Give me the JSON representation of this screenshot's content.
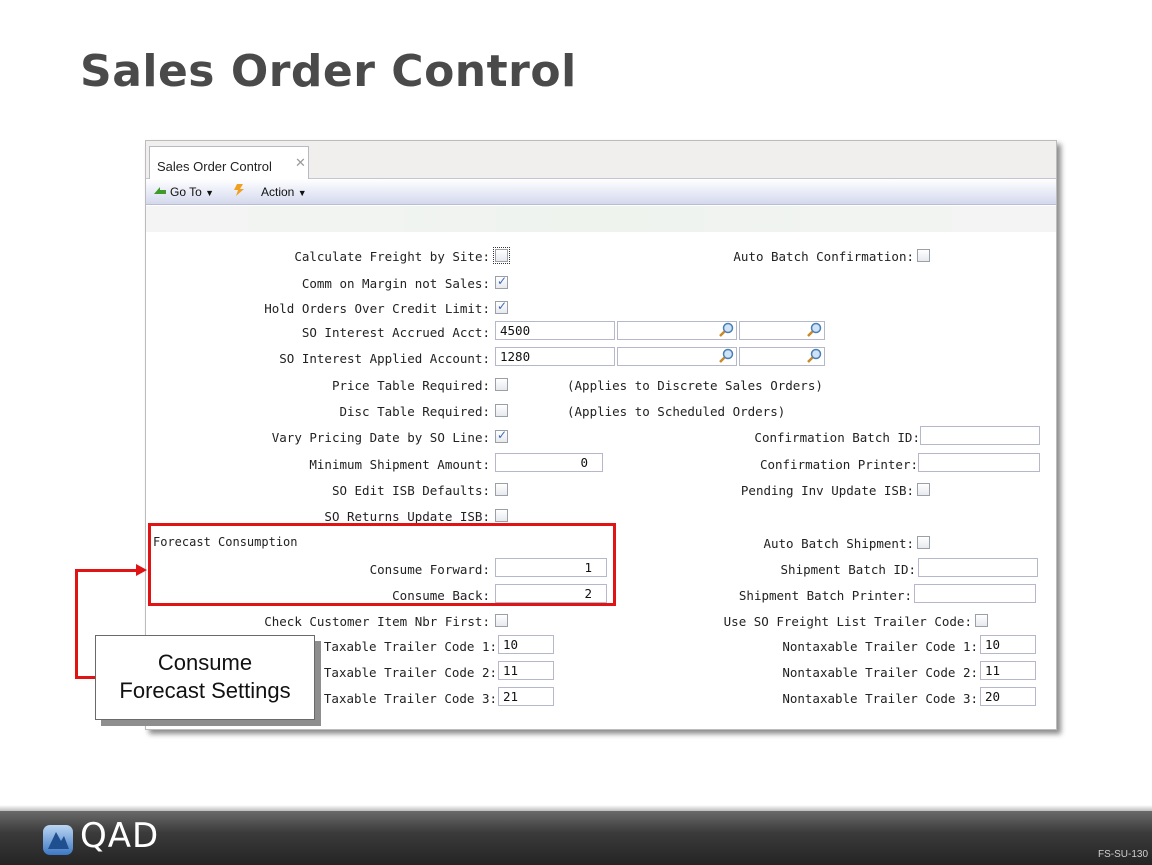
{
  "slide": {
    "title": "Sales Order Control",
    "footer_logo": "QAD",
    "slide_code": "FS-SU-130"
  },
  "window": {
    "tab_label": "Sales Order Control",
    "toolbar": {
      "goto_label": "Go To",
      "action_label": "Action"
    }
  },
  "form": {
    "calc_freight_label": "Calculate Freight by Site:",
    "calc_freight_checked": false,
    "comm_margin_label": "Comm on Margin not Sales:",
    "comm_margin_checked": true,
    "hold_orders_label": "Hold Orders Over Credit Limit:",
    "hold_orders_checked": true,
    "interest_accrued_label": "SO Interest Accrued Acct:",
    "interest_accrued_value": "4500",
    "interest_applied_label": "SO Interest Applied Account:",
    "interest_applied_value": "1280",
    "price_table_label": "Price Table Required:",
    "price_table_checked": false,
    "price_table_note": "(Applies to Discrete Sales Orders)",
    "disc_table_label": "Disc Table Required:",
    "disc_table_checked": false,
    "disc_table_note": "(Applies to Scheduled Orders)",
    "vary_pricing_label": "Vary Pricing Date by SO Line:",
    "vary_pricing_checked": true,
    "min_shipment_label": "Minimum Shipment Amount:",
    "min_shipment_value": "0",
    "edit_isb_label": "SO Edit ISB Defaults:",
    "edit_isb_checked": false,
    "returns_isb_label": "SO Returns Update ISB:",
    "returns_isb_checked": false,
    "forecast_section_label": "Forecast Consumption",
    "consume_forward_label": "Consume Forward:",
    "consume_forward_value": "1",
    "consume_back_label": "Consume Back:",
    "consume_back_value": "2",
    "check_customer_label": "Check Customer Item Nbr First:",
    "check_customer_checked": false,
    "taxable1_label": "Taxable Trailer Code 1:",
    "taxable1_value": "10",
    "taxable2_label": "Taxable Trailer Code 2:",
    "taxable2_value": "11",
    "taxable3_label": "Taxable Trailer Code 3:",
    "taxable3_value": "21",
    "auto_batch_confirm_label": "Auto Batch Confirmation:",
    "auto_batch_confirm_checked": false,
    "confirm_batch_id_label": "Confirmation Batch ID:",
    "confirm_batch_id_value": "",
    "confirm_printer_label": "Confirmation Printer:",
    "confirm_printer_value": "",
    "pending_inv_label": "Pending Inv Update ISB:",
    "pending_inv_checked": false,
    "auto_batch_ship_label": "Auto Batch Shipment:",
    "auto_batch_ship_checked": false,
    "ship_batch_id_label": "Shipment Batch ID:",
    "ship_batch_id_value": "",
    "ship_batch_printer_label": "Shipment Batch Printer:",
    "ship_batch_printer_value": "",
    "freight_list_label": "Use SO Freight List Trailer Code:",
    "freight_list_checked": false,
    "nontax1_label": "Nontaxable Trailer Code 1:",
    "nontax1_value": "10",
    "nontax2_label": "Nontaxable Trailer Code 2:",
    "nontax2_value": "11",
    "nontax3_label": "Nontaxable Trailer Code 3:",
    "nontax3_value": "20"
  },
  "callout": {
    "line1": "Consume",
    "line2": "Forecast Settings"
  },
  "colors": {
    "highlight": "#e01414",
    "check": "#3a6ab8"
  },
  "icons": [
    "goto-arrow-icon",
    "action-bolt-icon",
    "dropdown-caret-icon",
    "lookup-magnifier-icon",
    "close-icon",
    "qad-logo-icon"
  ]
}
